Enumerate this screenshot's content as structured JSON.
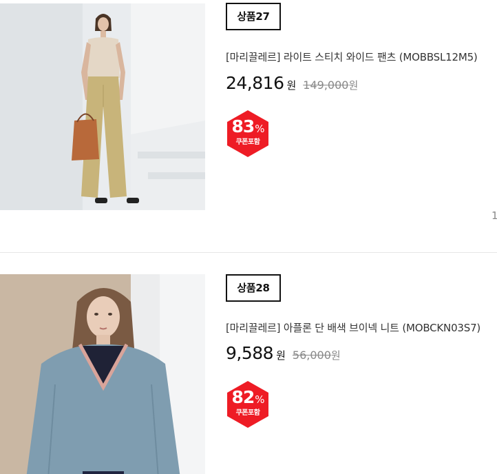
{
  "products": [
    {
      "tag": "상품27",
      "name": "[마리끌레르] 라이트 스티치 와이드 팬츠 (MOBBSL12M5)",
      "price": "24,816",
      "currency": "원",
      "original_price": "149,000",
      "original_currency": "원",
      "discount": "83",
      "discount_sign": "%",
      "discount_note": "쿠폰포함",
      "image": "model-wide-pants-photo"
    },
    {
      "tag": "상품28",
      "name": "[마리끌레르] 아플론 단 배색 브이넥 니트 (MOBCKN03S7)",
      "price": "9,588",
      "currency": "원",
      "original_price": "56,000",
      "original_currency": "원",
      "discount": "82",
      "discount_sign": "%",
      "discount_note": "쿠폰포함",
      "image": "model-vneck-knit-photo"
    }
  ],
  "side_indicator": "1",
  "colors": {
    "badge_red": "#ee1c25",
    "text_dark": "#111111",
    "text_muted": "#888888"
  }
}
